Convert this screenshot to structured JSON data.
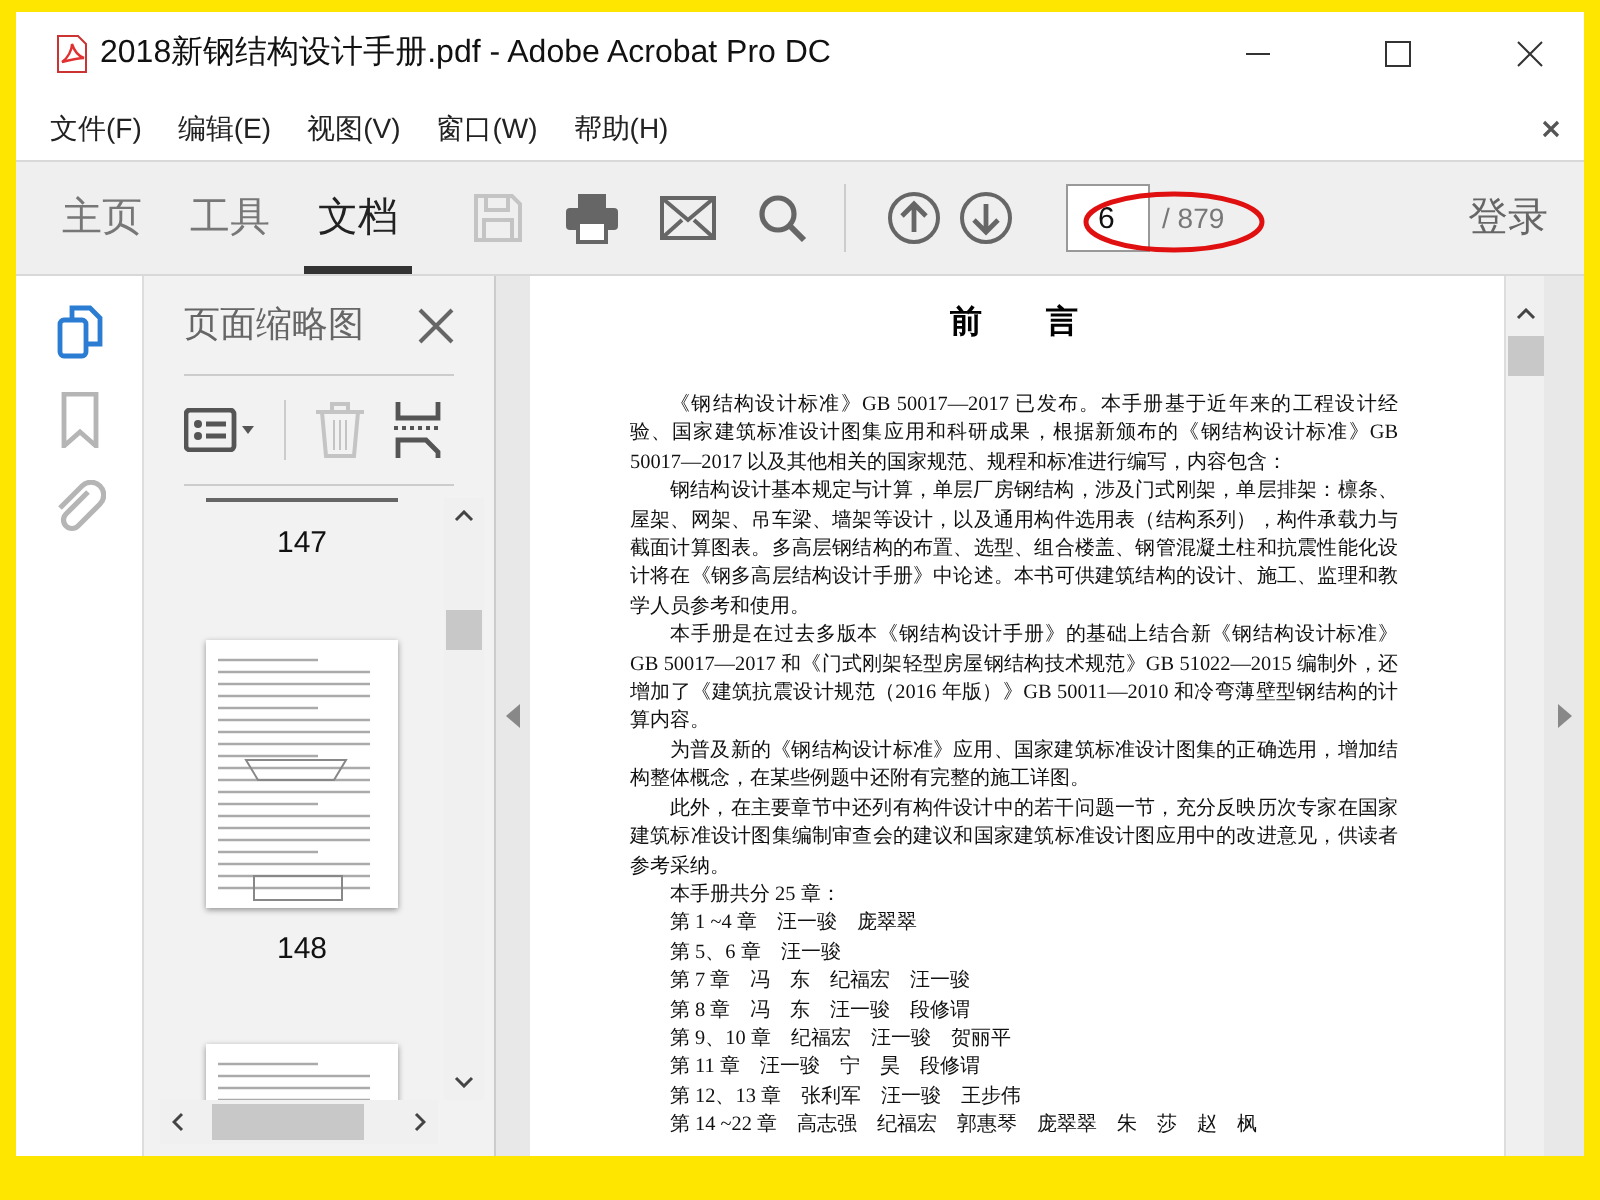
{
  "window": {
    "title": "2018新钢结构设计手册.pdf - Adobe Acrobat Pro DC"
  },
  "menu": [
    "文件(F)",
    "编辑(E)",
    "视图(V)",
    "窗口(W)",
    "帮助(H)"
  ],
  "tabs": [
    {
      "label": "主页",
      "selected": false
    },
    {
      "label": "工具",
      "selected": false
    },
    {
      "label": "文档",
      "selected": true
    }
  ],
  "toolbar": [
    {
      "kind": "save",
      "disabled": true
    },
    {
      "kind": "print",
      "disabled": false
    },
    {
      "kind": "mail",
      "disabled": false
    },
    {
      "kind": "search",
      "disabled": false
    }
  ],
  "page_nav": {
    "current": "6",
    "total": "/ 879"
  },
  "sign_in": "登录",
  "side_nav": [
    {
      "kind": "pages",
      "selected": true
    },
    {
      "kind": "bookmarks",
      "selected": false
    },
    {
      "kind": "attachments",
      "selected": false
    }
  ],
  "thumbnails_panel": {
    "title": "页面缩略图",
    "tools": [
      {
        "kind": "options",
        "disabled": false
      },
      {
        "kind": "delete",
        "disabled": true
      },
      {
        "kind": "crop",
        "disabled": false
      }
    ],
    "pages": [
      {
        "label": "147"
      },
      {
        "label": "148"
      }
    ]
  },
  "document": {
    "heading": "前　　言",
    "paragraphs": [
      "《钢结构设计标准》GB 50017—2017 已发布。本手册基于近年来的工程设计经验、国家建筑标准设计图集应用和科研成果，根据新颁布的《钢结构设计标准》GB 50017—2017 以及其他相关的国家规范、规程和标准进行编写，内容包含：",
      "钢结构设计基本规定与计算，单层厂房钢结构，涉及门式刚架，单层排架：檩条、屋架、网架、吊车梁、墙架等设计，以及通用构件选用表（结构系列），构件承载力与截面计算图表。多高层钢结构的布置、选型、组合楼盖、钢管混凝土柱和抗震性能化设计将在《钢多高层结构设计手册》中论述。本书可供建筑结构的设计、施工、监理和教学人员参考和使用。",
      "本手册是在过去多版本《钢结构设计手册》的基础上结合新《钢结构设计标准》GB 50017—2017 和《门式刚架轻型房屋钢结构技术规范》GB 51022—2015 编制外，还增加了《建筑抗震设计规范（2016 年版）》GB 50011—2010 和冷弯薄壁型钢结构的计算内容。",
      "为普及新的《钢结构设计标准》应用、国家建筑标准设计图集的正确选用，增加结构整体概念，在某些例题中还附有完整的施工详图。",
      "此外，在主要章节中还列有构件设计中的若干问题一节，充分反映历次专家在国家建筑标准设计图集编制审查会的建议和国家建筑标准设计图应用中的改进意见，供读者参考采纳。",
      "本手册共分 25 章："
    ],
    "chapters": [
      "第 1 ~4 章　汪一骏　庞翠翠",
      "第 5、6 章　汪一骏",
      "第 7 章　冯　东　纪福宏　汪一骏",
      "第 8 章　冯　东　汪一骏　段修谓",
      "第 9、10 章　纪福宏　汪一骏　贺丽平",
      "第 11 章　汪一骏　宁　昊　段修谓",
      "第 12、13 章　张利军　汪一骏　王步伟",
      "第 14 ~22 章　高志强　纪福宏　郭惠琴　庞翠翠　朱　莎　赵　枫"
    ]
  }
}
